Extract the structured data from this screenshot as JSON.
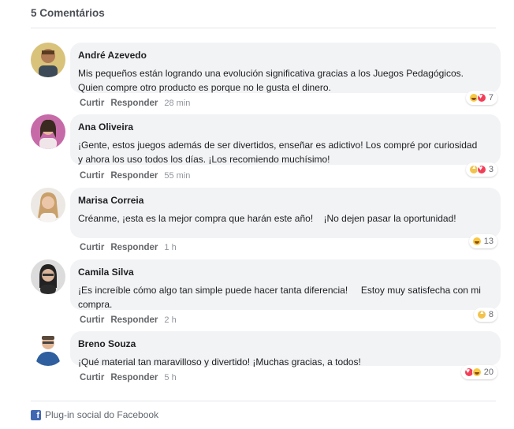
{
  "header": {
    "title": "5 Comentários"
  },
  "comments": [
    {
      "author": "André Azevedo",
      "text": "Mis pequeños están logrando una evolución significativa gracias a los Juegos Pedagógicos.\nQuien compre otro producto es porque no le gusta el dinero.",
      "like": "Curtir",
      "reply": "Responder",
      "time": "28 min",
      "reactions": [
        "haha",
        "love"
      ],
      "reaction_count": "7"
    },
    {
      "author": "Ana Oliveira",
      "text": "¡Gente, estos juegos además de ser divertidos, enseñar es adictivo! Los compré por curiosidad\ny ahora los uso todos los días. ¡Los recomiendo muchísimo!",
      "like": "Curtir",
      "reply": "Responder",
      "time": "55 min",
      "reactions": [
        "like",
        "love"
      ],
      "reaction_count": "3"
    },
    {
      "author": "Marisa Correia",
      "text": "Créanme, ¡esta es la mejor compra que harán este año!    ¡No dejen pasar la oportunidad!",
      "like": "Curtir",
      "reply": "Responder",
      "time": "1 h",
      "reactions": [
        "haha"
      ],
      "reaction_count": "13"
    },
    {
      "author": "Camila Silva",
      "text": "¡Es increíble cómo algo tan simple puede hacer tanta diferencia!     Estoy muy satisfecha con mi\ncompra.",
      "like": "Curtir",
      "reply": "Responder",
      "time": "2 h",
      "reactions": [
        "like"
      ],
      "reaction_count": "8"
    },
    {
      "author": "Breno Souza",
      "text": "¡Qué material tan maravilloso y divertido! ¡Muchas gracias, a todos!",
      "like": "Curtir",
      "reply": "Responder",
      "time": "5 h",
      "reactions": [
        "love",
        "haha"
      ],
      "reaction_count": "20"
    }
  ],
  "footer": {
    "icon": "facebook-icon",
    "label": "Plug-in social do Facebook"
  },
  "colors": {
    "bubble": "#f2f3f5",
    "text": "#1c1e21",
    "meta": "#65676b",
    "facebook": "#4267b2"
  }
}
